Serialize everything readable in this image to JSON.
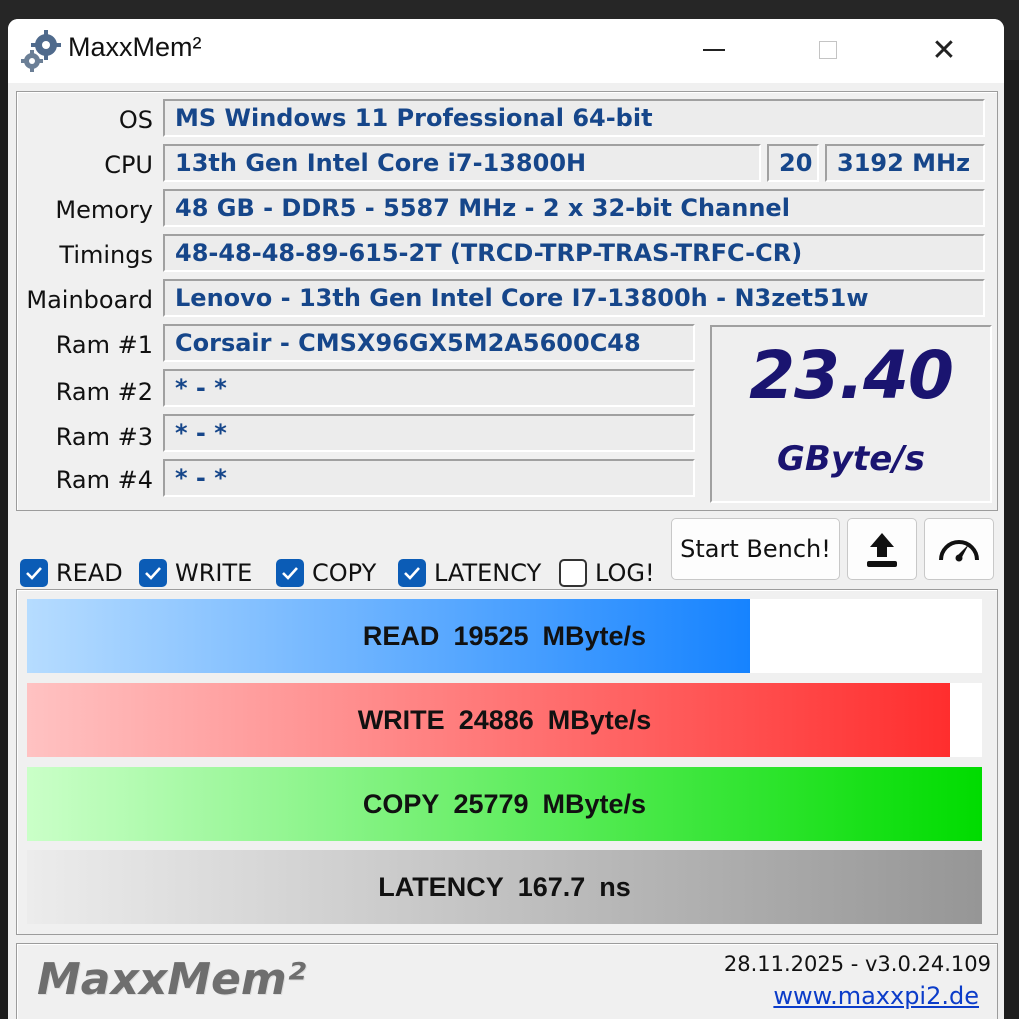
{
  "window": {
    "title": "MaxxMem²",
    "min_glyph": "—",
    "max_glyph": "□",
    "close_glyph": "✕"
  },
  "info": {
    "os": {
      "label": "OS",
      "value": "MS Windows 11 Professional 64-bit"
    },
    "cpu": {
      "label": "CPU",
      "value": "13th Gen Intel Core i7-13800H",
      "threads": "20",
      "freq": "3192 MHz"
    },
    "memory": {
      "label": "Memory",
      "value": "48 GB - DDR5 - 5587 MHz - 2 x 32-bit Channel"
    },
    "timings": {
      "label": "Timings",
      "value": "48-48-48-89-615-2T (TRCD-TRP-TRAS-TRFC-CR)"
    },
    "mainboard": {
      "label": "Mainboard",
      "value": "Lenovo - 13th Gen Intel Core I7-13800h - N3zet51w"
    },
    "ram": [
      {
        "label": "Ram #1",
        "value": "Corsair - CMSX96GX5M2A5600C48"
      },
      {
        "label": "Ram #2",
        "value": "* - *"
      },
      {
        "label": "Ram #3",
        "value": "* - *"
      },
      {
        "label": "Ram #4",
        "value": "* - *"
      }
    ]
  },
  "speed": {
    "value": "23.40",
    "unit": "GByte/s"
  },
  "options": [
    {
      "label": "READ",
      "checked": true
    },
    {
      "label": "WRITE",
      "checked": true
    },
    {
      "label": "COPY",
      "checked": true
    },
    {
      "label": "LATENCY",
      "checked": true
    },
    {
      "label": "LOG!",
      "checked": false
    }
  ],
  "buttons": {
    "start": "Start Bench!",
    "upload_icon": "upload-icon",
    "gauge_icon": "speedometer-icon"
  },
  "results": [
    {
      "name": "READ",
      "value": "19525",
      "unit": "MByte/s",
      "fill": 0.757,
      "color_from": "#b6dcff",
      "color_to": "#1683ff"
    },
    {
      "name": "WRITE",
      "value": "24886",
      "unit": "MByte/s",
      "fill": 0.966,
      "color_from": "#ffc2c2",
      "color_to": "#ff2e2e"
    },
    {
      "name": "COPY",
      "value": "25779",
      "unit": "MByte/s",
      "fill": 1.0,
      "color_from": "#caffc8",
      "color_to": "#00dc00"
    },
    {
      "name": "LATENCY",
      "value": "167.7",
      "unit": "ns",
      "fill": 1.0,
      "color_from": "#ececec",
      "color_to": "#969696"
    }
  ],
  "footer": {
    "logo": "MaxxMem²",
    "version": "28.11.2025 - v3.0.24.109",
    "link": "www.maxxpi2.de"
  },
  "colors": {
    "field_text": "#16468a",
    "speed_text": "#1a1470",
    "checkbox": "#0b5cb6",
    "link": "#0b3cc9"
  }
}
